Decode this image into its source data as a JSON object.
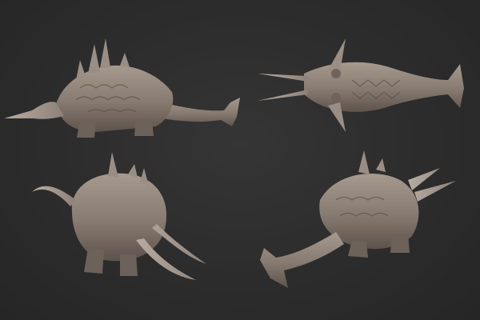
{
  "scene": {
    "background": "#2c2c2c",
    "sculpt_color": "#8a7d73",
    "shadow_color": "#5e544d",
    "highlight_color": "#a99c91"
  }
}
